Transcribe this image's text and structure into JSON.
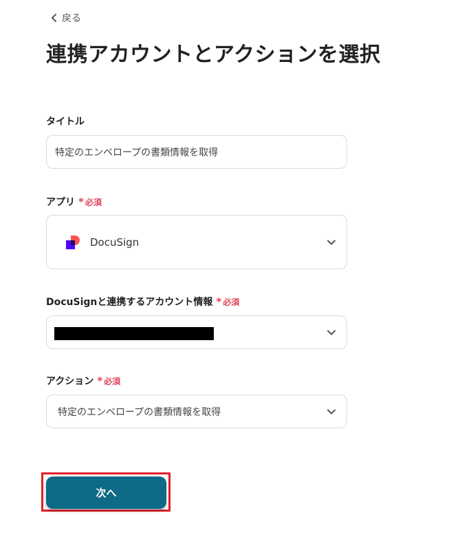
{
  "header": {
    "back_label": "戻る",
    "page_title": "連携アカウントとアクションを選択"
  },
  "form": {
    "title_field": {
      "label": "タイトル",
      "value": "特定のエンベロープの書類情報を取得"
    },
    "app_field": {
      "label": "アプリ",
      "required_star": "*",
      "required_label": "必須",
      "selected_app": "DocuSign",
      "app_icon": "docusign-logo-icon"
    },
    "account_field": {
      "label": "DocuSignと連携するアカウント情報",
      "required_star": "*",
      "required_label": "必須",
      "value_redacted": true
    },
    "action_field": {
      "label": "アクション",
      "required_star": "*",
      "required_label": "必須",
      "selected_action": "特定のエンベロープの書類情報を取得"
    }
  },
  "footer": {
    "next_label": "次へ"
  },
  "colors": {
    "primary_button": "#0e6a86",
    "required": "#e0455a",
    "highlight_outline": "#e0202a",
    "border": "#d9d9d9"
  }
}
